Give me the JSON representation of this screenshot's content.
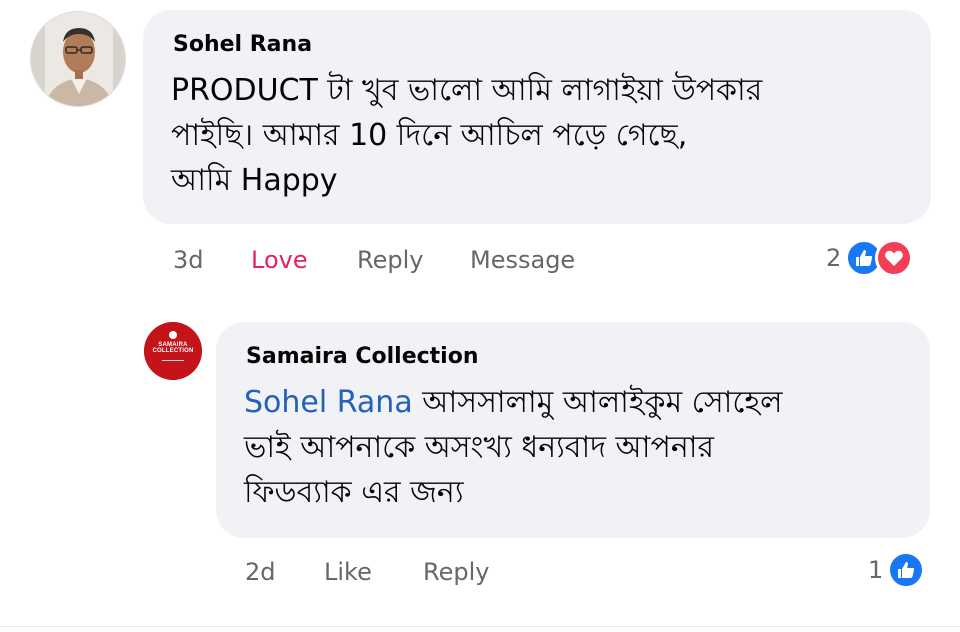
{
  "comments": [
    {
      "author": "Sohel Rana",
      "text_lines": [
        "PRODUCT টা খুব  ভালো  আমি লাগাইয়া উপকার",
        "পাইছি। আমার 10 দিনে আচিল পড়ে গেছে,",
        "আমি Happy"
      ],
      "time": "3d",
      "actions": [
        "Love",
        "Reply",
        "Message"
      ],
      "reaction_count": "2",
      "reactions": [
        "like-icon",
        "love-icon"
      ]
    },
    {
      "author": "Samaira Collection",
      "mention": "Sohel Rana",
      "text_lines": [
        " আসসালামু আলাইকুম সোহেল",
        "ভাই আপনাকে অসংখ্য ধন্যবাদ আপনার",
        "ফিডব্যাক এর জন্য"
      ],
      "time": "2d",
      "actions": [
        "Like",
        "Reply"
      ],
      "reaction_count": "1",
      "reactions": [
        "like-icon"
      ],
      "avatar_logo_lines": [
        "SAMAIRA",
        "COLLECTION"
      ]
    }
  ],
  "colors": {
    "bubble": "#f0f2f5",
    "love_action": "#e0245e",
    "mention": "#2561b8",
    "like_blue": "#1877f2",
    "love_red": "#f33e58"
  }
}
